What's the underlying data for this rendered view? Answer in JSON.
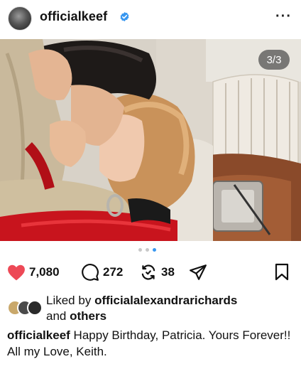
{
  "post": {
    "username": "officialkeef",
    "verified": true,
    "more_icon": "more-horizontal-icon",
    "image_counter": "3/3",
    "carousel": {
      "total": 3,
      "active_index": 2
    }
  },
  "actions": {
    "likes": "7,080",
    "comments": "272",
    "reposts": "38",
    "liked": true
  },
  "liked_by": {
    "prefix": "Liked by",
    "user": "officialalexandrarichards",
    "and": "and",
    "others": "others"
  },
  "caption": {
    "username": "officialkeef",
    "text": "Happy Birthday, Patricia. Yours Forever!!",
    "line2": "All my Love, Keith."
  },
  "colors": {
    "heart": "#ed4956",
    "verified": "#3897f0",
    "active_dot": "#3897f0"
  }
}
